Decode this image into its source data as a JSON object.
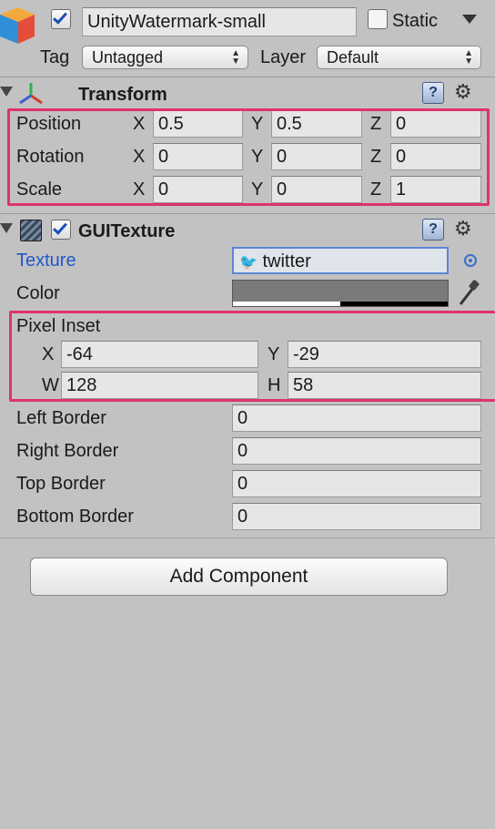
{
  "header": {
    "object_name": "UnityWatermark-small",
    "static_label": "Static",
    "tag_label": "Tag",
    "tag_value": "Untagged",
    "layer_label": "Layer",
    "layer_value": "Default"
  },
  "transform": {
    "title": "Transform",
    "rows": [
      {
        "label": "Position",
        "x": "0.5",
        "y": "0.5",
        "z": "0"
      },
      {
        "label": "Rotation",
        "x": "0",
        "y": "0",
        "z": "0"
      },
      {
        "label": "Scale",
        "x": "0",
        "y": "0",
        "z": "1"
      }
    ],
    "axis_x": "X",
    "axis_y": "Y",
    "axis_z": "Z"
  },
  "guitexture": {
    "title": "GUITexture",
    "texture_label": "Texture",
    "texture_value": "twitter",
    "color_label": "Color",
    "pixel_inset_label": "Pixel Inset",
    "inset": {
      "x_label": "X",
      "x": "-64",
      "y_label": "Y",
      "y": "-29",
      "w_label": "W",
      "w": "128",
      "h_label": "H",
      "h": "58"
    },
    "borders": [
      {
        "label": "Left Border",
        "value": "0"
      },
      {
        "label": "Right Border",
        "value": "0"
      },
      {
        "label": "Top Border",
        "value": "0"
      },
      {
        "label": "Bottom Border",
        "value": "0"
      }
    ]
  },
  "add_component_label": "Add Component",
  "colors": {
    "highlight": "#e0336b",
    "link_blue": "#2157c8",
    "panel_bg": "#c2c2c2"
  }
}
